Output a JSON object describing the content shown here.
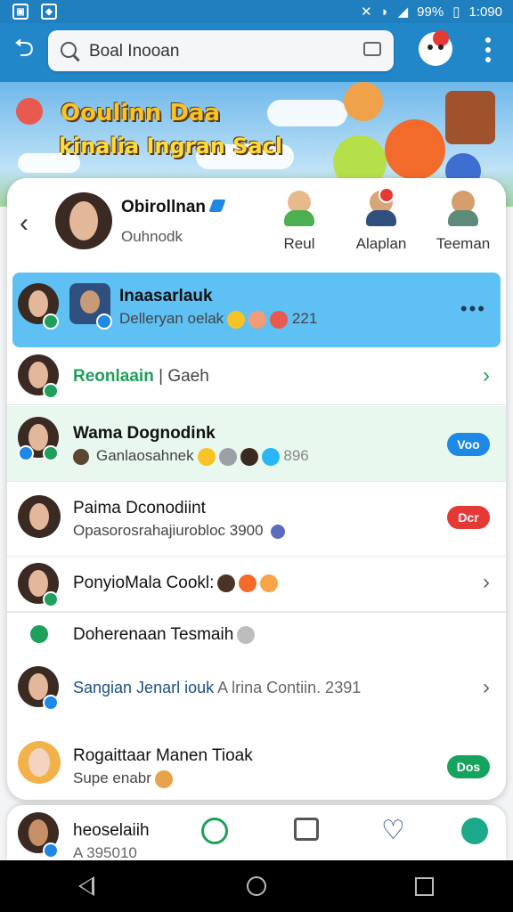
{
  "status_bar": {
    "battery": "99%",
    "time": "1:090"
  },
  "search": {
    "placeholder": "Boal Inooan"
  },
  "banner": {
    "line1": "Ooulinn Daa",
    "line2": "kinalia Ingran Sacl"
  },
  "profile": {
    "name": "Obirollnan",
    "subtitle": "Ouhnodk"
  },
  "contacts": [
    {
      "label": "Reul"
    },
    {
      "label": "Alaplan"
    },
    {
      "label": "Teeman"
    }
  ],
  "rows": [
    {
      "name": "Inaasarlauk",
      "preview": "Delleryan oelak",
      "count": "221"
    },
    {
      "name": "Reonlaain",
      "sep": "|",
      "extra": "Gaeh"
    },
    {
      "name": "Wama Dognodink",
      "preview": "Ganlaosahnek",
      "count": "896",
      "badge": "Voo"
    },
    {
      "name": "Paima Dconodiint",
      "preview": "Opasorosrahajiurobloc 3900",
      "badge": "Dcr"
    },
    {
      "name": "PonyioMala Cookl:"
    },
    {
      "name": "Doherenaan Tesmaih"
    },
    {
      "name": "Sangian Jenarl iouk",
      "preview": "A lrina Contiin. 2391"
    },
    {
      "name": "Rogaittaar Manen Tioak",
      "preview": "Supe enabr",
      "badge": "Dos"
    }
  ],
  "bottom": {
    "name": "heoselaiih",
    "sub": "A 395010"
  },
  "colors": {
    "appbar": "#2287c8",
    "highlight": "#5fc0f3",
    "green": "#1ea05a",
    "red": "#e53935",
    "blue": "#1e88e5"
  }
}
